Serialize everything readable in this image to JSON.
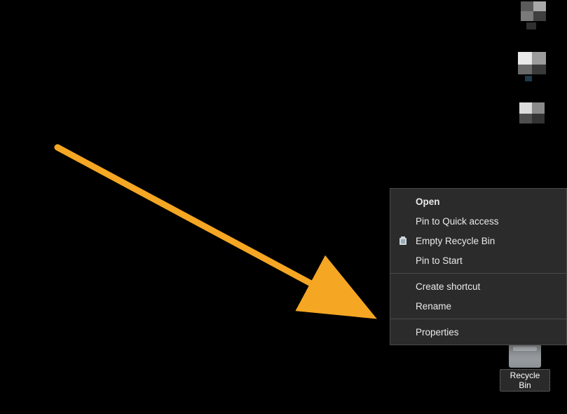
{
  "desktop": {
    "recycle_bin_label": "Recycle Bin"
  },
  "context_menu": {
    "open": "Open",
    "pin_quick_access": "Pin to Quick access",
    "empty_recycle_bin": "Empty Recycle Bin",
    "pin_to_start": "Pin to Start",
    "create_shortcut": "Create shortcut",
    "rename": "Rename",
    "properties": "Properties"
  },
  "annotation": {
    "arrow_color": "#f5a623"
  }
}
